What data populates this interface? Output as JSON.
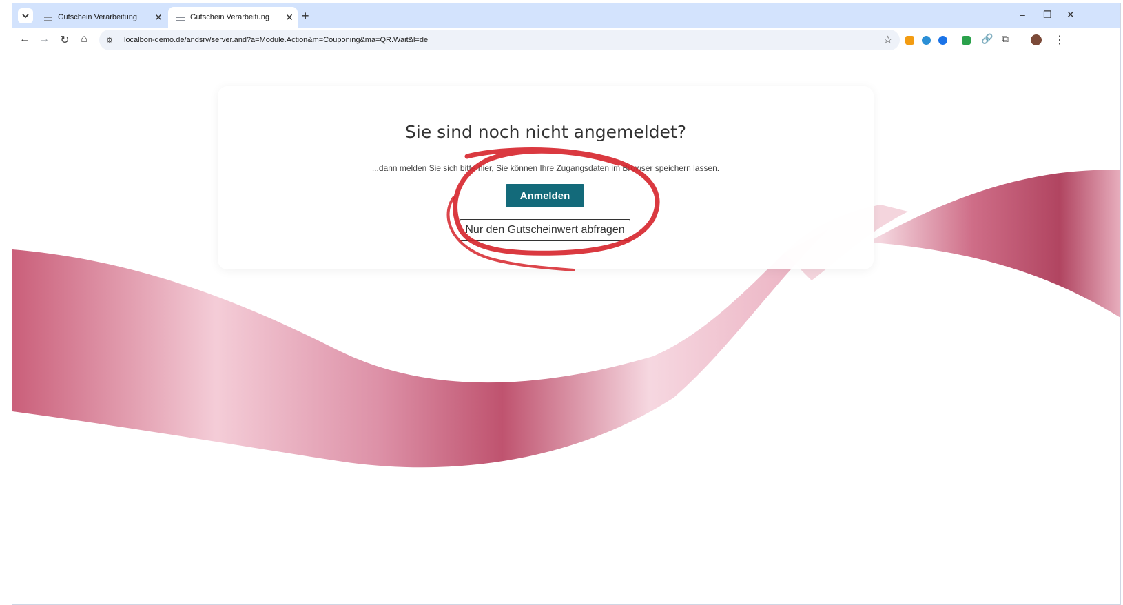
{
  "browser": {
    "tabs": [
      {
        "title": "Gutschein Verarbeitung",
        "active": false
      },
      {
        "title": "Gutschein Verarbeitung",
        "active": true
      }
    ],
    "tab_close": "✕",
    "new_tab": "+",
    "url": "localbon-demo.de/andsrv/server.and?a=Module.Action&m=Couponing&ma=QR.Wait&l=de"
  },
  "page": {
    "heading": "Sie sind noch nicht angemeldet?",
    "subtext": "...dann melden Sie sich bitte hier, Sie können Ihre Zugangsdaten im Browser speichern lassen.",
    "login_button": "Anmelden",
    "value_button": "Nur den Gutscheinwert abfragen"
  },
  "colors": {
    "primary_button": "#136a7a",
    "annotation": "#d6242b",
    "ribbon": "#c94c6a"
  }
}
